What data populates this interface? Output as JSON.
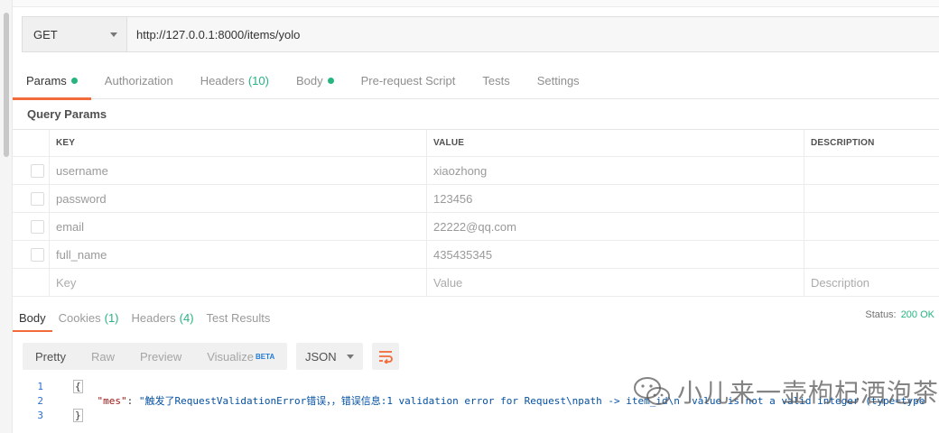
{
  "request": {
    "method": "GET",
    "url": "http://127.0.0.1:8000/items/yolo"
  },
  "request_tabs": [
    {
      "label": "Params",
      "count": "",
      "dot": true,
      "active": true
    },
    {
      "label": "Authorization",
      "count": "",
      "dot": false,
      "active": false
    },
    {
      "label": "Headers",
      "count": "(10)",
      "dot": false,
      "active": false
    },
    {
      "label": "Body",
      "count": "",
      "dot": true,
      "active": false
    },
    {
      "label": "Pre-request Script",
      "count": "",
      "dot": false,
      "active": false
    },
    {
      "label": "Tests",
      "count": "",
      "dot": false,
      "active": false
    },
    {
      "label": "Settings",
      "count": "",
      "dot": false,
      "active": false
    }
  ],
  "query_params": {
    "title": "Query Params",
    "headers": {
      "key": "KEY",
      "value": "VALUE",
      "description": "DESCRIPTION"
    },
    "rows": [
      {
        "key": "username",
        "value": "xiaozhong",
        "description": ""
      },
      {
        "key": "password",
        "value": "123456",
        "description": ""
      },
      {
        "key": "email",
        "value": "22222@qq.com",
        "description": ""
      },
      {
        "key": "full_name",
        "value": "435435345",
        "description": ""
      }
    ],
    "placeholder": {
      "key": "Key",
      "value": "Value",
      "description": "Description"
    }
  },
  "response_tabs": [
    {
      "label": "Body",
      "count": "",
      "active": true
    },
    {
      "label": "Cookies",
      "count": "(1)",
      "active": false
    },
    {
      "label": "Headers",
      "count": "(4)",
      "active": false
    },
    {
      "label": "Test Results",
      "count": "",
      "active": false
    }
  ],
  "status": {
    "label": "Status:",
    "value": "200 OK"
  },
  "view_modes": {
    "pretty": "Pretty",
    "raw": "Raw",
    "preview": "Preview",
    "visualize": "Visualize",
    "beta": "BETA",
    "format": "JSON"
  },
  "code": {
    "line_numbers": [
      "1",
      "2",
      "3"
    ],
    "open_brace": "{",
    "key": "\"mes\"",
    "colon": ": ",
    "value": "\"触发了RequestValidationError错误，，错误信息:1 validation error for Request\\npath -> item_id\\n  value is not a valid integer (type=type",
    "close_brace": "}"
  },
  "watermark": "小儿来一壶枸杞酒泡茶",
  "colors": {
    "accent": "#f26b3a",
    "success": "#26b47f",
    "beta": "#1f7bd8"
  }
}
